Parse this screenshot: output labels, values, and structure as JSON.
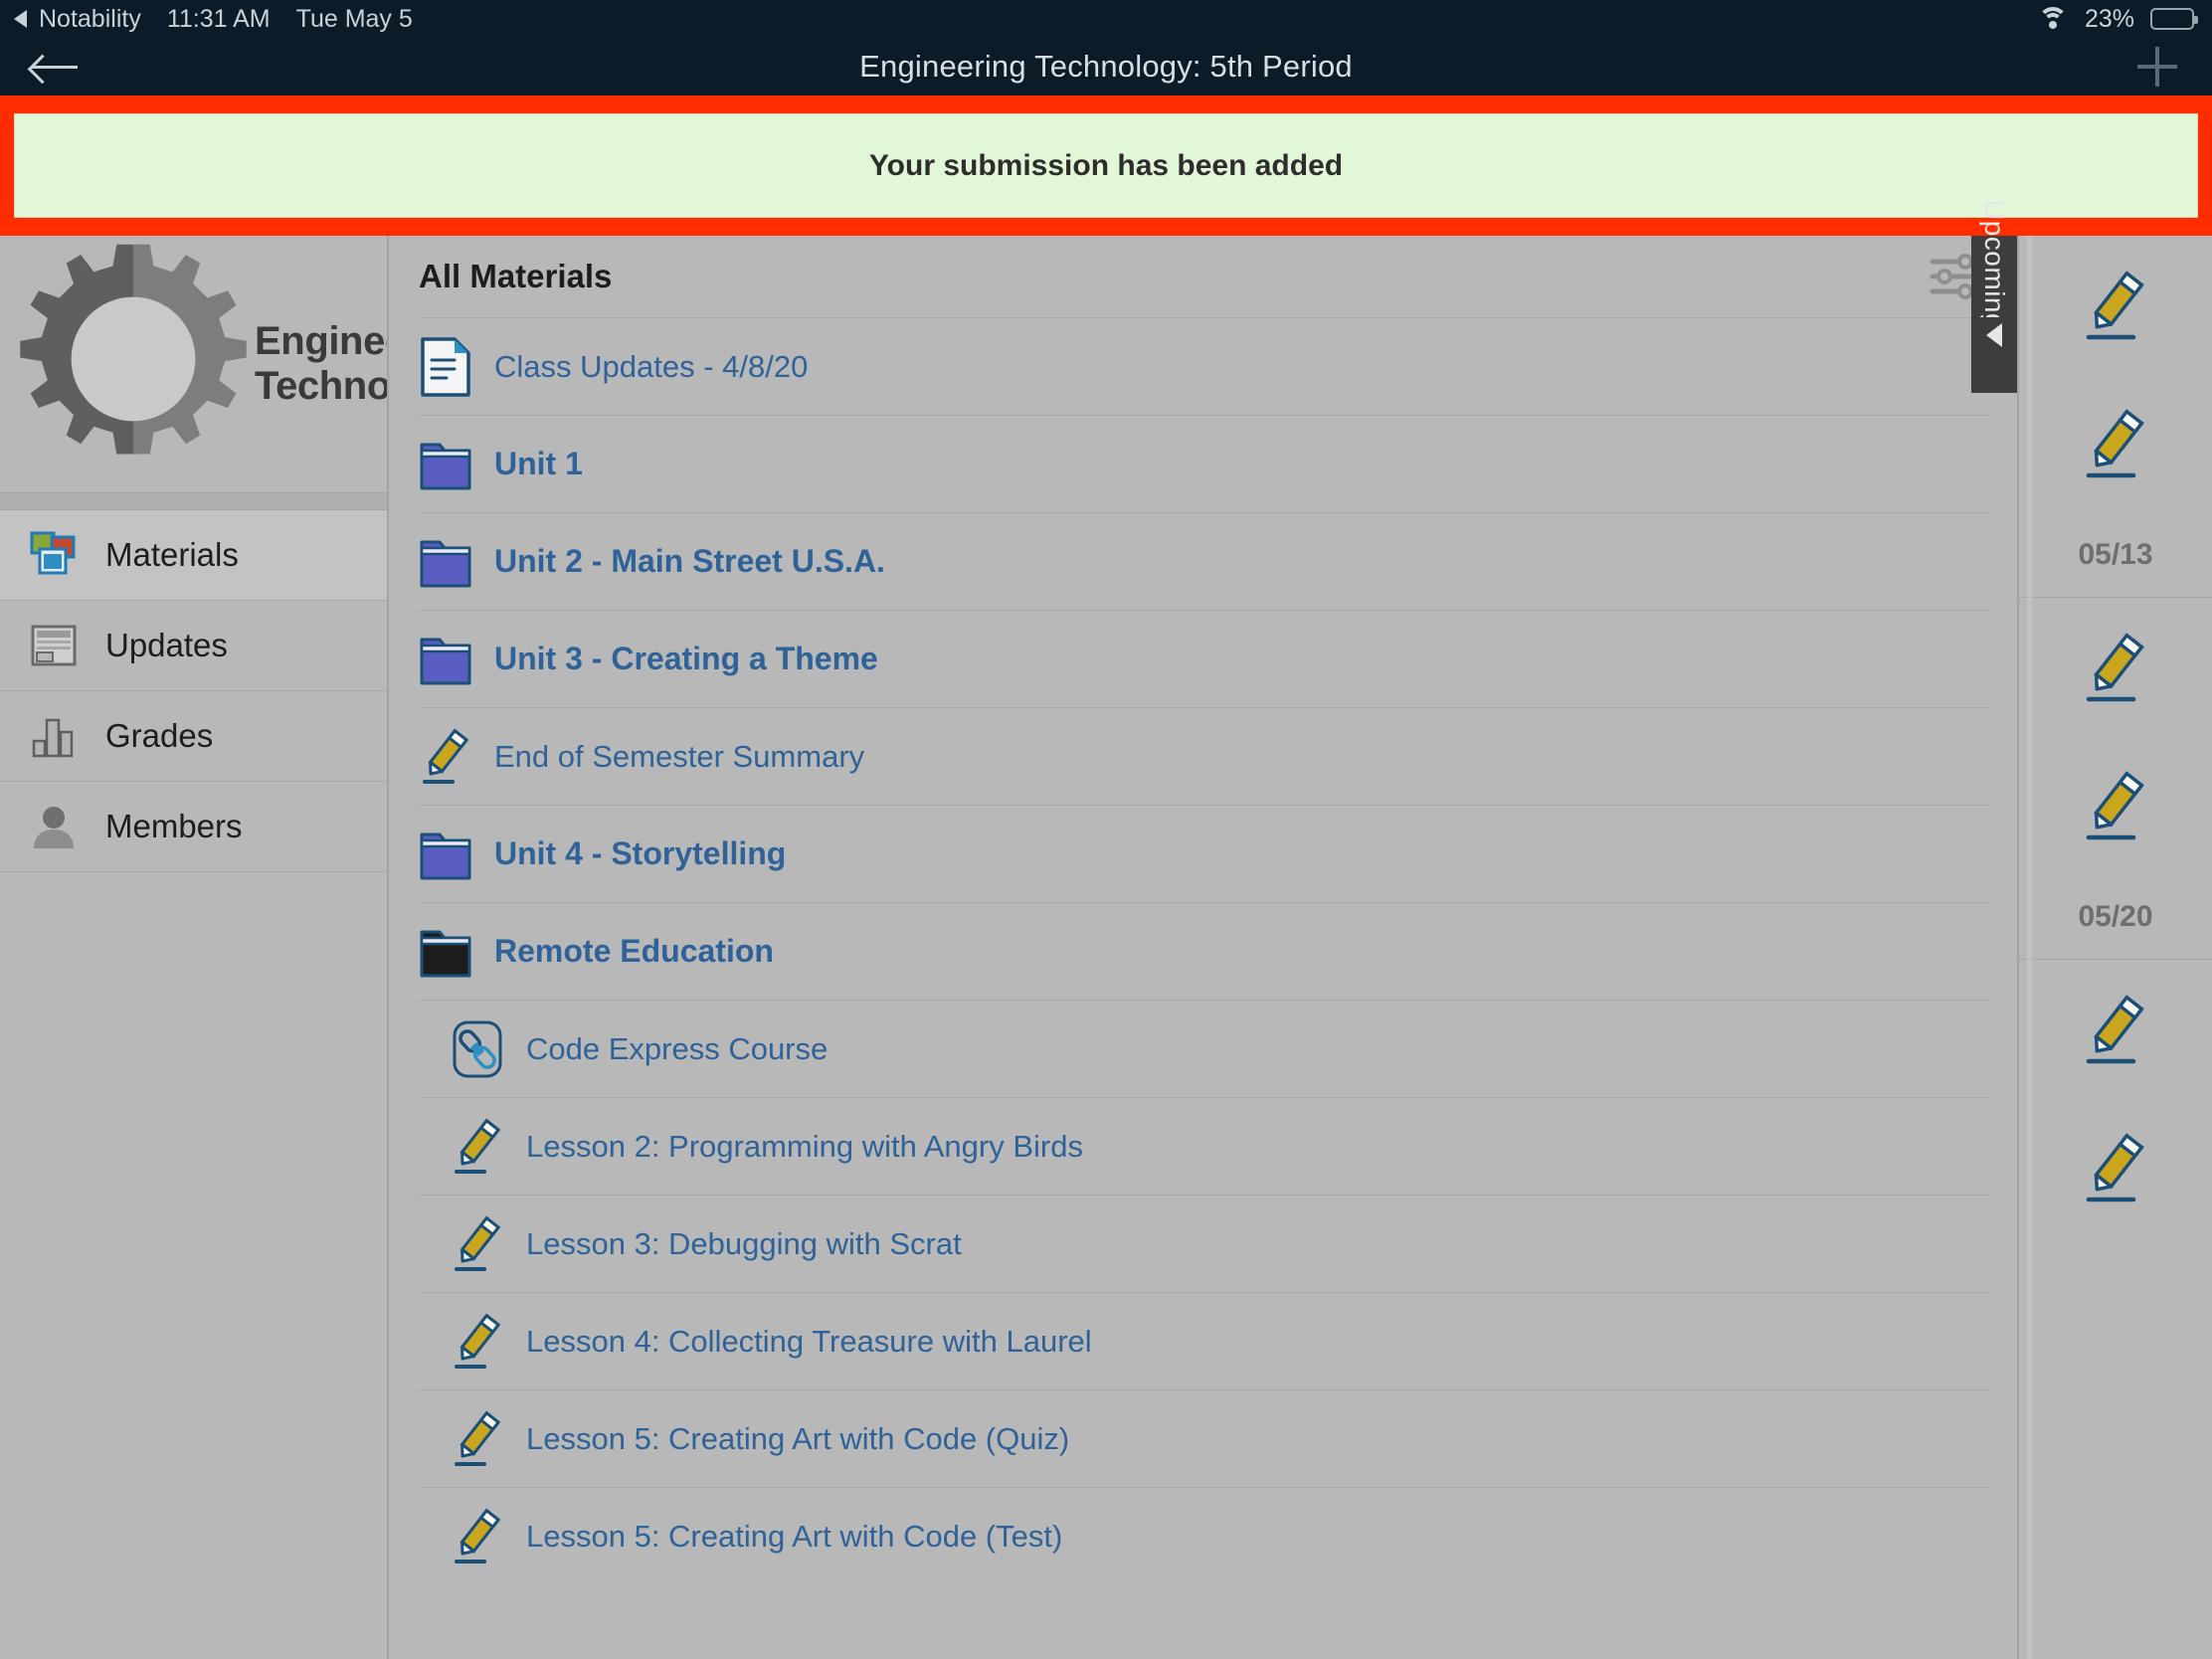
{
  "status_bar": {
    "app_name": "Notability",
    "time": "11:31 AM",
    "date": "Tue May 5",
    "battery_percent": "23%",
    "battery_level": 23,
    "wifi_icon": "wifi-icon",
    "back_triangle_icon": "back-triangle-icon",
    "battery_icon": "battery-icon"
  },
  "navbar": {
    "title": "Engineering Technology: 5th Period",
    "back_icon": "arrow-left-icon",
    "add_icon": "plus-icon"
  },
  "banner": {
    "message": "Your submission has been added",
    "background_color": "#e2f7d8",
    "highlight_color": "#ff2d00"
  },
  "sidebar": {
    "logo_line1": "Engineering",
    "logo_line2": "Technology",
    "logo_icon": "gear-icon",
    "items": [
      {
        "label": "Materials",
        "icon": "materials-icon",
        "active": true
      },
      {
        "label": "Updates",
        "icon": "updates-icon",
        "active": false
      },
      {
        "label": "Grades",
        "icon": "grades-bar-chart-icon",
        "active": false
      },
      {
        "label": "Members",
        "icon": "members-person-icon",
        "active": false
      }
    ]
  },
  "main": {
    "title": "All Materials",
    "filter_icon": "sliders-filter-icon",
    "rows": [
      {
        "label": "Class Updates - 4/8/20",
        "icon": "document-icon",
        "bold": false,
        "indent": false
      },
      {
        "label": "Unit 1",
        "icon": "folder-icon",
        "bold": true,
        "indent": false
      },
      {
        "label": "Unit 2 - Main Street U.S.A.",
        "icon": "folder-icon",
        "bold": true,
        "indent": false
      },
      {
        "label": "Unit 3 - Creating a Theme",
        "icon": "folder-icon",
        "bold": true,
        "indent": false
      },
      {
        "label": "End of Semester Summary",
        "icon": "pencil-icon",
        "bold": false,
        "indent": false
      },
      {
        "label": "Unit 4 - Storytelling",
        "icon": "folder-icon",
        "bold": true,
        "indent": false
      },
      {
        "label": "Remote Education",
        "icon": "folder-dark-icon",
        "bold": true,
        "indent": false
      },
      {
        "label": "Code Express Course",
        "icon": "link-icon",
        "bold": false,
        "indent": true
      },
      {
        "label": "Lesson 2: Programming with Angry Birds",
        "icon": "pencil-icon",
        "bold": false,
        "indent": true
      },
      {
        "label": "Lesson 3: Debugging with Scrat",
        "icon": "pencil-icon",
        "bold": false,
        "indent": true
      },
      {
        "label": "Lesson 4: Collecting Treasure with Laurel",
        "icon": "pencil-icon",
        "bold": false,
        "indent": true
      },
      {
        "label": "Lesson 5: Creating Art with Code (Quiz)",
        "icon": "pencil-icon",
        "bold": false,
        "indent": true
      },
      {
        "label": "Lesson 5: Creating Art with Code (Test)",
        "icon": "pencil-icon",
        "bold": false,
        "indent": true
      }
    ]
  },
  "upcoming_tab": {
    "label": "Upcoming",
    "collapse_icon": "triangle-left-icon"
  },
  "upcoming_rail": {
    "entries": [
      {
        "type": "assignment",
        "icon": "pencil-icon"
      },
      {
        "type": "assignment",
        "icon": "pencil-icon"
      },
      {
        "type": "date",
        "label": "05/13"
      },
      {
        "type": "assignment",
        "icon": "pencil-icon"
      },
      {
        "type": "assignment",
        "icon": "pencil-icon"
      },
      {
        "type": "date",
        "label": "05/20"
      },
      {
        "type": "assignment",
        "icon": "pencil-icon"
      },
      {
        "type": "assignment",
        "icon": "pencil-icon"
      }
    ]
  }
}
